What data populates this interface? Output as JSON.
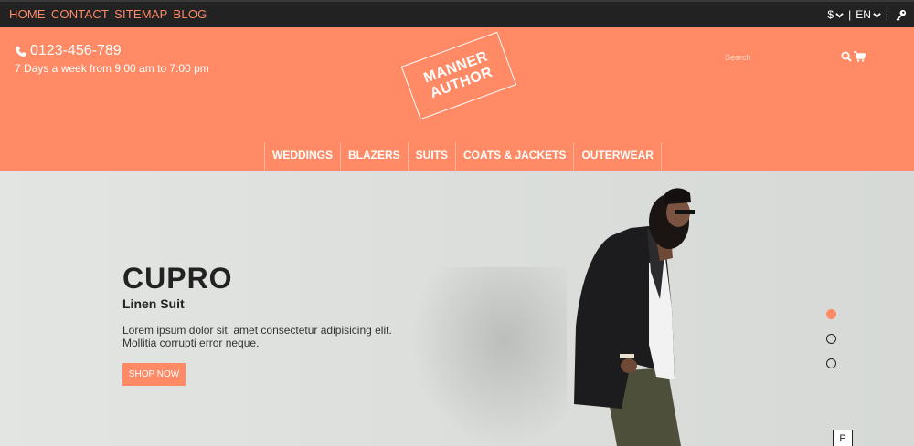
{
  "topbar": {
    "links": [
      "HOME",
      "CONTACT",
      "SITEMAP",
      "BLOG"
    ],
    "currency": "$",
    "language": "EN",
    "separator": "|"
  },
  "header": {
    "phone": "0123-456-789",
    "hours": "7 Days a week from 9:00 am to 7:00 pm",
    "logo": [
      "MANNER",
      "AUTHOR"
    ],
    "search_placeholder": "Search",
    "nav": [
      "WEDDINGS",
      "BLAZERS",
      "SUITS",
      "COATS & JACKETS",
      "OUTERWEAR"
    ]
  },
  "hero": {
    "title": "CUPRO",
    "subtitle": "Linen Suit",
    "text_line1": "Lorem ipsum dolor sit, amet consectetur adipisicing elit.",
    "text_line2": "Mollitia corrupti error neque.",
    "button": "SHOP NOW",
    "slides": 3,
    "active_slide": 1,
    "p_label": "P"
  },
  "colors": {
    "accent": "#ff8a65",
    "topbar": "#222222",
    "text_dark": "#222222"
  },
  "icons": [
    "chevron-down-icon",
    "key-icon",
    "phone-icon",
    "search-icon",
    "cart-icon"
  ]
}
